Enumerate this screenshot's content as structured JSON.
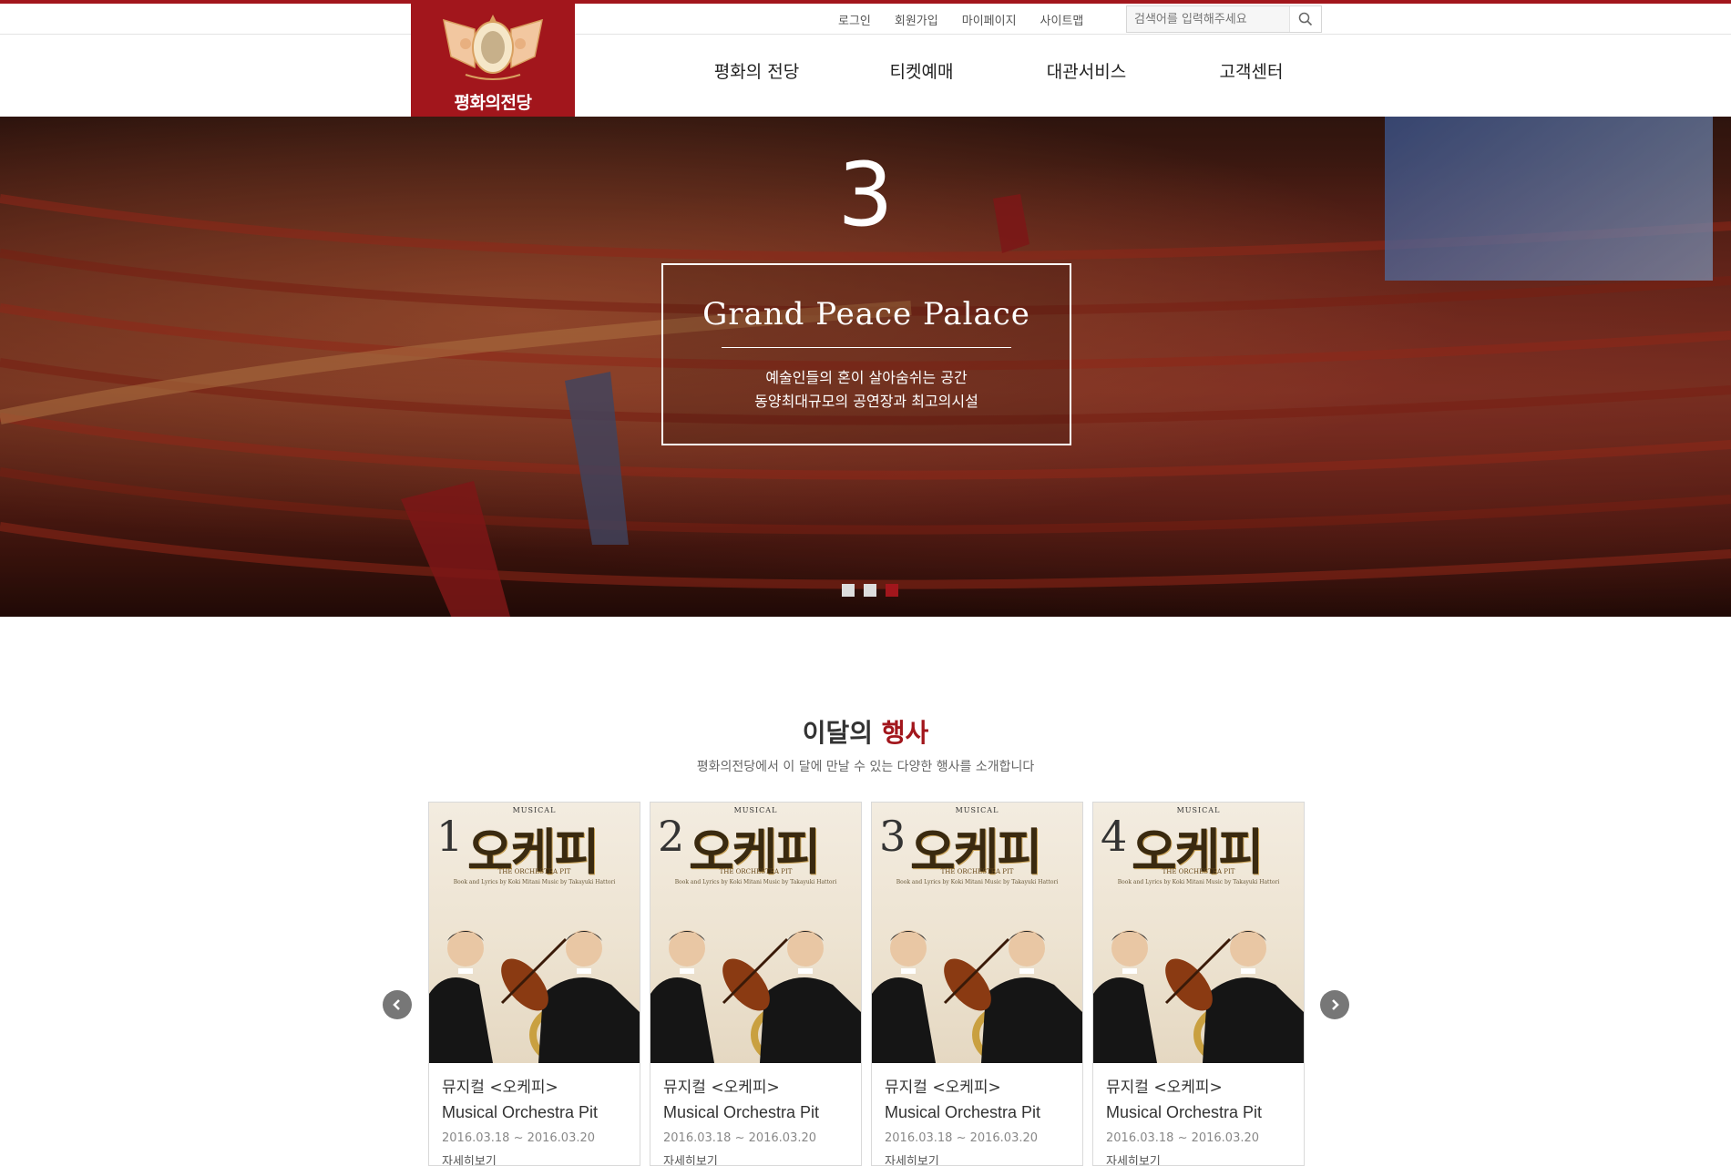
{
  "brand": {
    "name": "평화의전당",
    "color": "#a2161c"
  },
  "util": {
    "links": [
      {
        "label": "로그인"
      },
      {
        "label": "회원가입"
      },
      {
        "label": "마이페이지"
      },
      {
        "label": "사이트맵"
      }
    ],
    "search": {
      "placeholder": "검색어를 입력해주세요",
      "icon": "search-icon"
    }
  },
  "nav": {
    "items": [
      {
        "label": "평화의 전당"
      },
      {
        "label": "티켓예매"
      },
      {
        "label": "대관서비스"
      },
      {
        "label": "고객센터"
      }
    ]
  },
  "hero": {
    "number": "3",
    "title": "Grand Peace Palace",
    "line1": "예술인들의 혼이 살아숨쉬는 공간",
    "line2": "동양최대규모의 공연장과 최고의시설",
    "dots": 3,
    "active_dot": 3
  },
  "events": {
    "title_plain": "이달의",
    "title_accent": "행사",
    "subtitle": "평화의전당에서 이 달에 만날 수 있는 다양한 행사를 소개합니다",
    "prev_icon": "chevron-left-icon",
    "next_icon": "chevron-right-icon",
    "cards": [
      {
        "num": "1",
        "poster_label": "MUSICAL",
        "poster_title": "오케피",
        "poster_sub": "THE ORCHESTRA PIT",
        "poster_credit": "Book and Lyrics by Koki Mitani   Music by Takayuki Hattori",
        "category": "뮤지컬 <오케피>",
        "name": "Musical Orchestra Pit",
        "date": "2016.03.18 ~ 2016.03.20",
        "more": "자세히보기"
      },
      {
        "num": "2",
        "poster_label": "MUSICAL",
        "poster_title": "오케피",
        "poster_sub": "THE ORCHESTRA PIT",
        "poster_credit": "Book and Lyrics by Koki Mitani   Music by Takayuki Hattori",
        "category": "뮤지컬 <오케피>",
        "name": "Musical Orchestra Pit",
        "date": "2016.03.18 ~ 2016.03.20",
        "more": "자세히보기"
      },
      {
        "num": "3",
        "poster_label": "MUSICAL",
        "poster_title": "오케피",
        "poster_sub": "THE ORCHESTRA PIT",
        "poster_credit": "Book and Lyrics by Koki Mitani   Music by Takayuki Hattori",
        "category": "뮤지컬 <오케피>",
        "name": "Musical Orchestra Pit",
        "date": "2016.03.18 ~ 2016.03.20",
        "more": "자세히보기"
      },
      {
        "num": "4",
        "poster_label": "MUSICAL",
        "poster_title": "오케피",
        "poster_sub": "THE ORCHESTRA PIT",
        "poster_credit": "Book and Lyrics by Koki Mitani   Music by Takayuki Hattori",
        "category": "뮤지컬 <오케피>",
        "name": "Musical Orchestra Pit",
        "date": "2016.03.18 ~ 2016.03.20",
        "more": "자세히보기"
      }
    ]
  }
}
